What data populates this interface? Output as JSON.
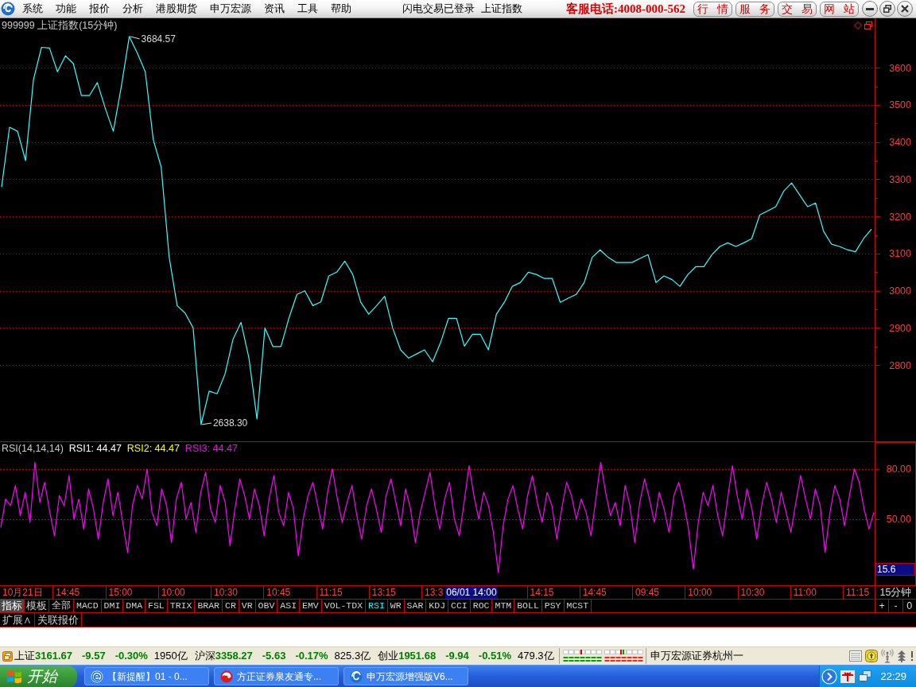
{
  "menu_bar": {
    "items": [
      "系统",
      "功能",
      "报价",
      "分析",
      "港股期货",
      "申万宏源",
      "资讯",
      "工具",
      "帮助"
    ],
    "login_status": "闪电交易已登录",
    "current_index": "上证指数",
    "hotline": "客服电话:4008-000-562",
    "buttons": [
      "行 情",
      "服 务",
      "交 易",
      "网 站"
    ]
  },
  "price_chart": {
    "title": "999999 上证指数(15分钟)",
    "chart_data": {
      "type": "line",
      "ylim": [
        2595,
        3733
      ],
      "yticks": [
        2800,
        2900,
        3000,
        3100,
        3200,
        3300,
        3400,
        3500,
        3600
      ],
      "grid": true,
      "series": [
        {
          "color": "#33ffff",
          "values": [
            3279,
            3440,
            3429,
            3350,
            3568,
            3655,
            3653,
            3589,
            3632,
            3611,
            3525,
            3525,
            3560,
            3490,
            3429,
            3550,
            3684,
            3640,
            3589,
            3407,
            3333,
            3090,
            2960,
            2940,
            2900,
            2640,
            2730,
            2723,
            2776,
            2870,
            2915,
            2819,
            2655,
            2900,
            2850,
            2850,
            2926,
            2990,
            3000,
            2960,
            2970,
            3040,
            3050,
            3080,
            3044,
            2969,
            2937,
            2960,
            2985,
            2900,
            2841,
            2819,
            2830,
            2841,
            2809,
            2860,
            2926,
            2926,
            2851,
            2883,
            2883,
            2841,
            2937,
            2969,
            3012,
            3022,
            3050,
            3044,
            3033,
            3033,
            2969,
            2980,
            2990,
            3022,
            3090,
            3110,
            3090,
            3076,
            3076,
            3076,
            3087,
            3097,
            3022,
            3040,
            3030,
            3012,
            3044,
            3065,
            3065,
            3097,
            3119,
            3129,
            3119,
            3129,
            3140,
            3204,
            3215,
            3226,
            3268,
            3290,
            3258,
            3226,
            3236,
            3160,
            3125,
            3119,
            3110,
            3105,
            3140,
            3166
          ]
        }
      ],
      "annotations": [
        {
          "text": "3684.57"
        },
        {
          "text": "2638.30"
        }
      ]
    }
  },
  "rsi_panel": {
    "title": "RSI(14,14,14)",
    "readings": [
      {
        "text": "RSI1: 44.47",
        "color": "#ffffff"
      },
      {
        "text": "RSI2: 44.47",
        "color": "#ffff00"
      },
      {
        "text": "RSI3: 44.47",
        "color": "#ff00ff"
      }
    ],
    "cursor_value": "15.6",
    "chart_data": {
      "type": "line",
      "ylim": [
        10,
        96
      ],
      "yticks": [
        {
          "value": 80,
          "label": "80.00"
        },
        {
          "value": 50,
          "label": "50.00"
        }
      ],
      "grid": true,
      "series": [
        {
          "color": "#ff00ff",
          "values": [
            45,
            62,
            58,
            70,
            52,
            66,
            48,
            84,
            60,
            72,
            55,
            40,
            64,
            58,
            76,
            50,
            62,
            44,
            68,
            56,
            38,
            60,
            74,
            52,
            66,
            48,
            30,
            58,
            70,
            62,
            80,
            54,
            46,
            68,
            58,
            36,
            62,
            72,
            50,
            60,
            42,
            66,
            78,
            56,
            48,
            70,
            60,
            34,
            56,
            74,
            64,
            50,
            68,
            58,
            40,
            62,
            76,
            54,
            46,
            66,
            56,
            28,
            50,
            64,
            72,
            58,
            44,
            66,
            80,
            62,
            48,
            60,
            70,
            52,
            38,
            58,
            68,
            56,
            42,
            64,
            74,
            60,
            46,
            68,
            56,
            36,
            54,
            66,
            78,
            58,
            44,
            62,
            72,
            50,
            40,
            60,
            82,
            64,
            50,
            66,
            58,
            42,
            18,
            46,
            62,
            70,
            56,
            44,
            64,
            76,
            60,
            48,
            66,
            58,
            38,
            56,
            72,
            64,
            50,
            62,
            54,
            40,
            62,
            84,
            66,
            52,
            60,
            46,
            70,
            58,
            36,
            60,
            74,
            62,
            48,
            66,
            56,
            42,
            64,
            72,
            60,
            44,
            20,
            48,
            66,
            58,
            70,
            52,
            40,
            62,
            82,
            64,
            50,
            68,
            56,
            38,
            58,
            72,
            62,
            48,
            66,
            54,
            42,
            60,
            76,
            62,
            50,
            68,
            58,
            30,
            54,
            70,
            62,
            46,
            64,
            80,
            72,
            56,
            44,
            54
          ]
        }
      ]
    }
  },
  "time_axis": {
    "labels": [
      {
        "text": "10月21日",
        "kind": "tick"
      },
      {
        "text": "14:45",
        "kind": "tick"
      },
      {
        "text": "15:00",
        "kind": "tick"
      },
      {
        "text": "10:00",
        "kind": "tick"
      },
      {
        "text": "10:30",
        "kind": "tick"
      },
      {
        "text": "10:45",
        "kind": "tick"
      },
      {
        "text": "11:15",
        "kind": "tick"
      },
      {
        "text": "13:15",
        "kind": "tick"
      },
      {
        "text": "13:3",
        "kind": "tick"
      },
      {
        "text": "06/01 14:00",
        "kind": "cursor"
      },
      {
        "text": "14:15",
        "kind": "tick"
      },
      {
        "text": "14:45",
        "kind": "tick"
      },
      {
        "text": "09:45",
        "kind": "tick"
      },
      {
        "text": "10:00",
        "kind": "tick"
      },
      {
        "text": "10:30",
        "kind": "tick"
      },
      {
        "text": "11:00",
        "kind": "tick"
      },
      {
        "text": "11:15",
        "kind": "tick"
      }
    ],
    "period": "15分钟"
  },
  "mode_tabs": [
    {
      "label": "指标",
      "selected": true
    },
    {
      "label": "模板",
      "selected": false
    }
  ],
  "indicator_tabs": [
    {
      "label": "全部",
      "selected": false
    },
    {
      "label": "MACD",
      "selected": false
    },
    {
      "label": "DMI",
      "selected": false
    },
    {
      "label": "DMA",
      "selected": false
    },
    {
      "label": "FSL",
      "selected": false
    },
    {
      "label": "TRIX",
      "selected": false
    },
    {
      "label": "BRAR",
      "selected": false
    },
    {
      "label": "CR",
      "selected": false
    },
    {
      "label": "VR",
      "selected": false
    },
    {
      "label": "OBV",
      "selected": false
    },
    {
      "label": "ASI",
      "selected": false
    },
    {
      "label": "EMV",
      "selected": false
    },
    {
      "label": "VOL-TDX",
      "selected": false
    },
    {
      "label": "RSI",
      "selected": true
    },
    {
      "label": "WR",
      "selected": false
    },
    {
      "label": "SAR",
      "selected": false
    },
    {
      "label": "KDJ",
      "selected": false
    },
    {
      "label": "CCI",
      "selected": false
    },
    {
      "label": "ROC",
      "selected": false
    },
    {
      "label": "MTM",
      "selected": false
    },
    {
      "label": "BOLL",
      "selected": false
    },
    {
      "label": "PSY",
      "selected": false
    },
    {
      "label": "MCST",
      "selected": false
    }
  ],
  "zoom_buttons": [
    "+",
    "-",
    "0"
  ],
  "extra_tabs": [
    "扩展∧",
    "关联报价"
  ],
  "status_bar": {
    "indices": [
      {
        "name": "上证",
        "value": "3161.67",
        "change": "-9.57",
        "percent": "-0.30%",
        "turnover": "1950亿",
        "falling": true
      },
      {
        "name": "沪深",
        "value": "3358.27",
        "change": "-5.63",
        "percent": "-0.17%",
        "turnover": "825.3亿",
        "falling": true
      },
      {
        "name": "创业",
        "value": "1951.68",
        "change": "-9.94",
        "percent": "-0.51%",
        "turnover": "479.3亿",
        "falling": true
      }
    ],
    "branch": "申万宏源证券杭州一"
  },
  "taskbar": {
    "start": "开始",
    "tasks": [
      "【新提醒】01 - 0...",
      "方正证券泉友通专...",
      "申万宏源增强版V6..."
    ],
    "clock": "22:29"
  }
}
